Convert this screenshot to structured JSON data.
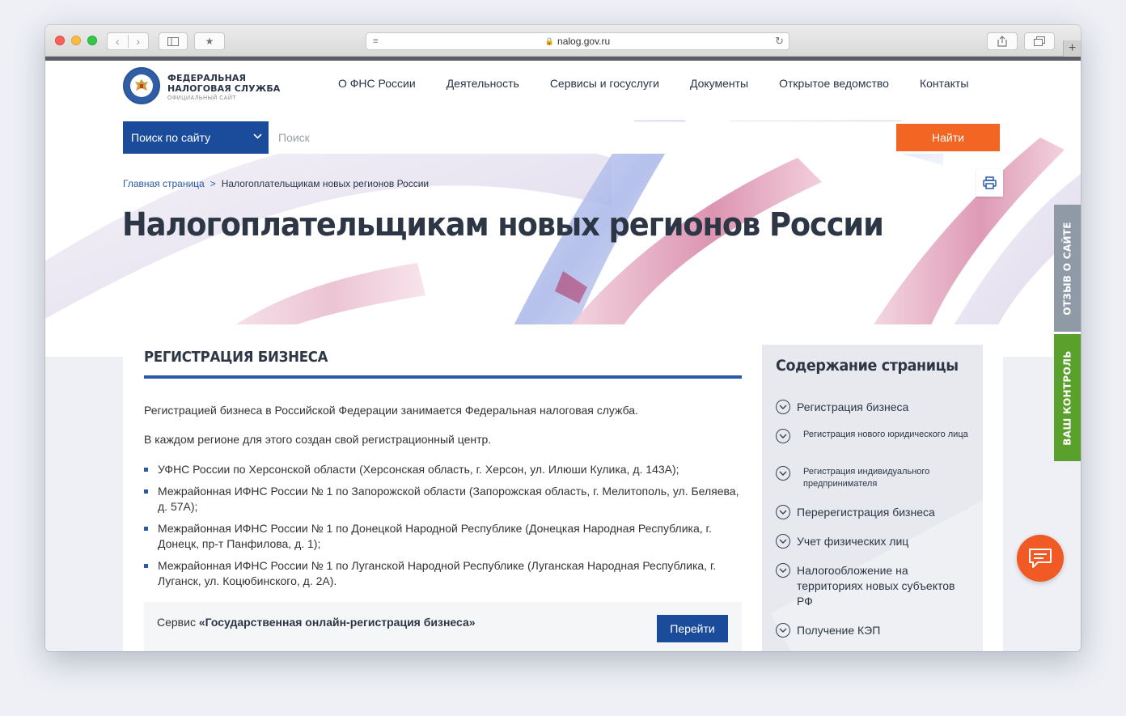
{
  "browser": {
    "url": "nalog.gov.ru",
    "new_tab": "+"
  },
  "header": {
    "logo_line1": "ФЕДЕРАЛЬНАЯ",
    "logo_line2": "НАЛОГОВАЯ СЛУЖБА",
    "logo_sub": "ОФИЦИАЛЬНЫЙ САЙТ",
    "nav": [
      {
        "label": "О ФНС России"
      },
      {
        "label": "Деятельность"
      },
      {
        "label": "Сервисы и госуслуги"
      },
      {
        "label": "Документы"
      },
      {
        "label": "Открытое ведомство"
      },
      {
        "label": "Контакты"
      }
    ]
  },
  "search": {
    "scope": "Поиск по сайту",
    "placeholder": "Поиск",
    "button": "Найти"
  },
  "breadcrumb": {
    "home": "Главная страница",
    "separator": ">",
    "current": "Налогоплательщикам новых регионов России"
  },
  "page": {
    "title": "Налогоплательщикам новых регионов России"
  },
  "section": {
    "heading": "РЕГИСТРАЦИЯ БИЗНЕСА",
    "p1": "Регистрацией бизнеса в Российской Федерации занимается Федеральная налоговая служба.",
    "p2": "В каждом регионе для этого создан свой регистрационный центр.",
    "items": [
      "УФНС России по Херсонской области (Херсонская область, г. Херсон, ул. Илюши Кулика, д. 143А);",
      "Межрайонная ИФНС России № 1 по Запорожской области (Запорожская область, г. Мелитополь, ул. Беляева, д. 57А);",
      "Межрайонная ИФНС России № 1 по Донецкой Народной Республике (Донецкая Народная Республика, г. Донецк, пр-т Панфилова, д. 1);",
      "Межрайонная ИФНС России № 1 по Луганской Народной Республике (Луганская Народная Республика, г. Луганск, ул. Коцюбинского, д. 2А)."
    ],
    "service_prefix": "Сервис ",
    "service_name": "«Государственная онлайн-регистрация бизнеса»",
    "service_button": "Перейти"
  },
  "toc": {
    "title": "Содержание страницы",
    "items": [
      {
        "label": "Регистрация бизнеса"
      },
      {
        "label": "Регистрация нового юридического лица"
      },
      {
        "label": "Регистрация индивидуального предпринимателя"
      },
      {
        "label": "Перерегистрация бизнеса"
      },
      {
        "label": "Учет физических лиц"
      },
      {
        "label": "Налогообложение на территориях новых субъектов РФ"
      },
      {
        "label": "Получение КЭП"
      }
    ]
  },
  "side_tabs": {
    "feedback": "ОТЗЫВ О САЙТЕ",
    "control": "ВАШ КОНТРОЛЬ"
  },
  "colors": {
    "brand_blue": "#1b4c9c",
    "accent_orange": "#f26522",
    "feedback_grey": "#8f9aa6",
    "control_green": "#5aa02c"
  }
}
